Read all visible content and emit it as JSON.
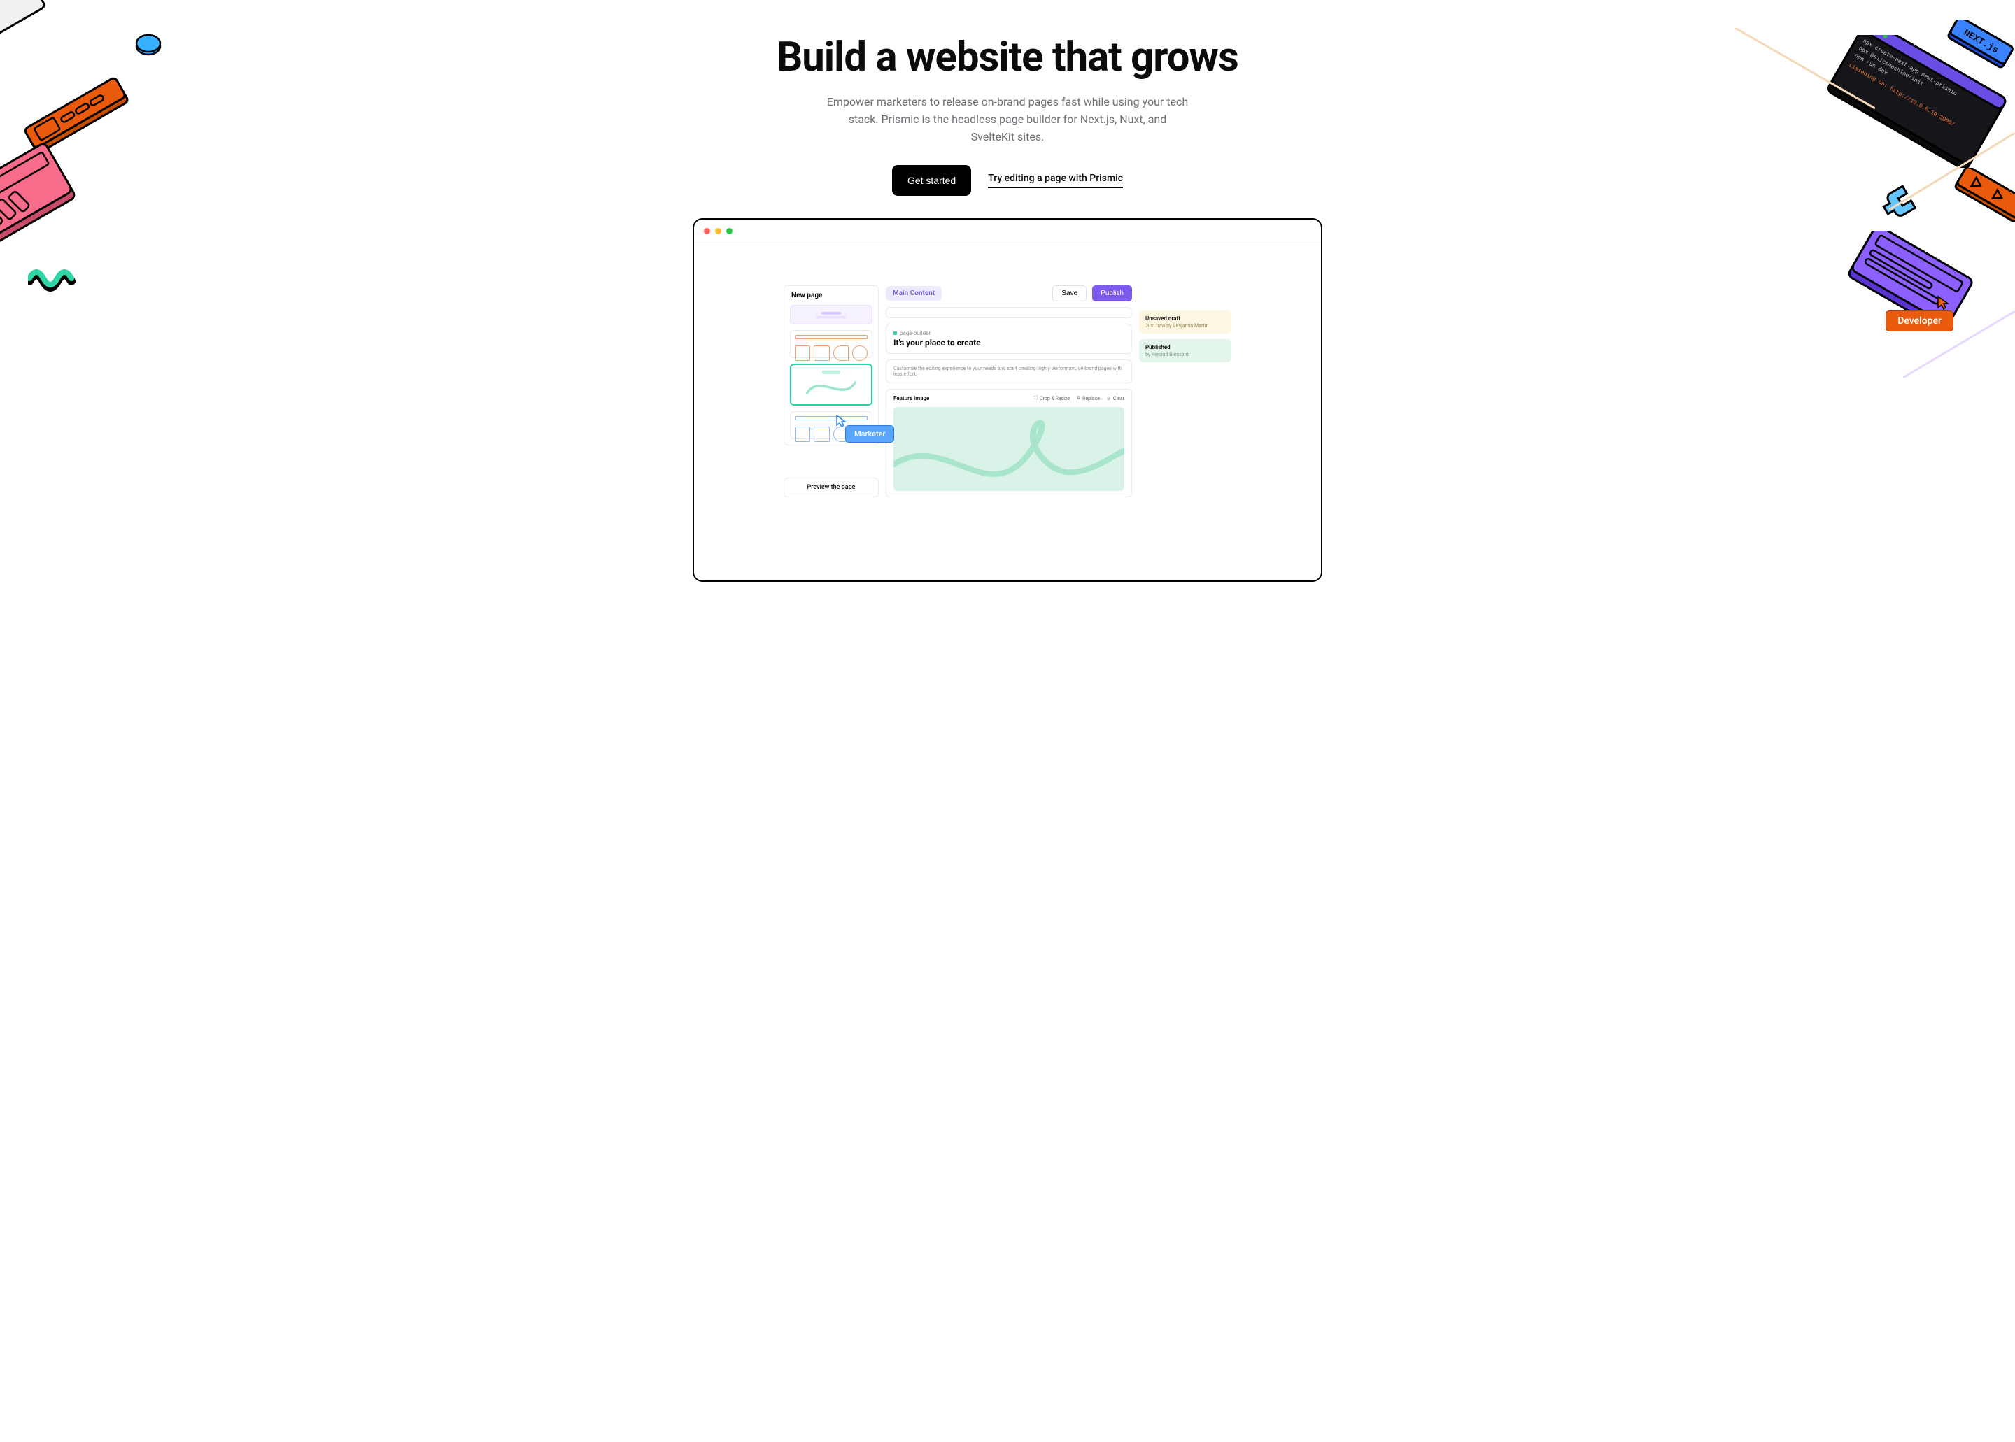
{
  "hero": {
    "headline": "Build a website that grows",
    "subhead": "Empower marketers to release on-brand pages fast while using your tech stack. Prismic is the headless page builder for Next.js, Nuxt, and SvelteKit sites.",
    "cta_primary": "Get started",
    "cta_secondary": "Try editing a page with Prismic"
  },
  "editor": {
    "new_page": "New page",
    "preview": "Preview the page",
    "main_content": "Main Content",
    "save": "Save",
    "publish": "Publish",
    "page_builder_label": "page-builder",
    "title_value": "It's your place to create",
    "description": "Customize the editing experience to your needs and start creating highly performant, on-brand pages with less effort.",
    "feature_label": "Feature image",
    "actions": {
      "crop": "Crop & Resize",
      "replace": "Replace",
      "clear": "Clear"
    },
    "draft": {
      "title": "Unsaved draft",
      "by": "Just now by Benjamin Martin"
    },
    "published": {
      "title": "Published",
      "by": "by Renaud Bressand"
    }
  },
  "badges": {
    "marketer": "Marketer",
    "developer": "Developer"
  },
  "decor": {
    "nextjs": "NEXT.js",
    "term1": "npx create-next-app next-prismic",
    "term2": "npx @slicemachine/init",
    "term3": "npm run dev",
    "term4": "Listening on: http://10.0.0.10:3000/"
  }
}
